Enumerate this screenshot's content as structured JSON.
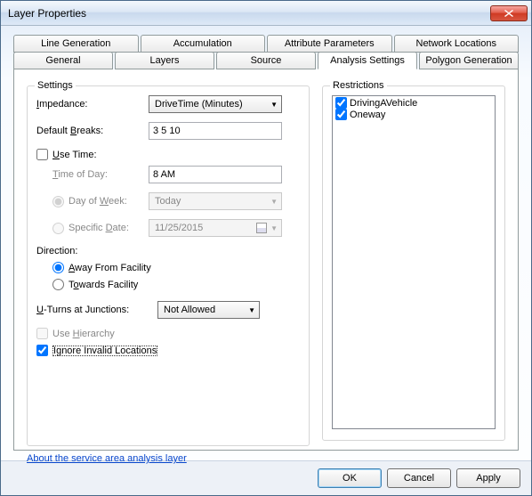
{
  "window": {
    "title": "Layer Properties"
  },
  "tabs": {
    "row1": [
      "Line Generation",
      "Accumulation",
      "Attribute Parameters",
      "Network Locations"
    ],
    "row2": [
      "General",
      "Layers",
      "Source",
      "Analysis Settings",
      "Polygon Generation"
    ],
    "active": "Analysis Settings"
  },
  "settings": {
    "group_label": "Settings",
    "impedance_label": "Impedance:",
    "impedance_value": "DriveTime (Minutes)",
    "default_breaks_label": "Default Breaks:",
    "default_breaks_value": "3 5 10",
    "use_time_label": "Use Time:",
    "use_time_checked": false,
    "time_of_day_label": "Time of Day:",
    "time_of_day_value": "8 AM",
    "day_of_week_label": "Day of Week:",
    "day_of_week_value": "Today",
    "specific_date_label": "Specific Date:",
    "specific_date_value": "11/25/2015",
    "direction_label": "Direction:",
    "away_label": "Away From Facility",
    "towards_label": "Towards Facility",
    "direction_selected": "away",
    "uturns_label": "U-Turns at Junctions:",
    "uturns_value": "Not Allowed",
    "use_hierarchy_label": "Use Hierarchy",
    "use_hierarchy_checked": false,
    "use_hierarchy_enabled": false,
    "ignore_label": "Ignore Invalid Locations",
    "ignore_checked": true
  },
  "restrictions": {
    "group_label": "Restrictions",
    "items": [
      {
        "label": "DrivingAVehicle",
        "checked": true
      },
      {
        "label": "Oneway",
        "checked": true
      }
    ]
  },
  "link_text": "About the service area analysis layer",
  "buttons": {
    "ok": "OK",
    "cancel": "Cancel",
    "apply": "Apply"
  }
}
